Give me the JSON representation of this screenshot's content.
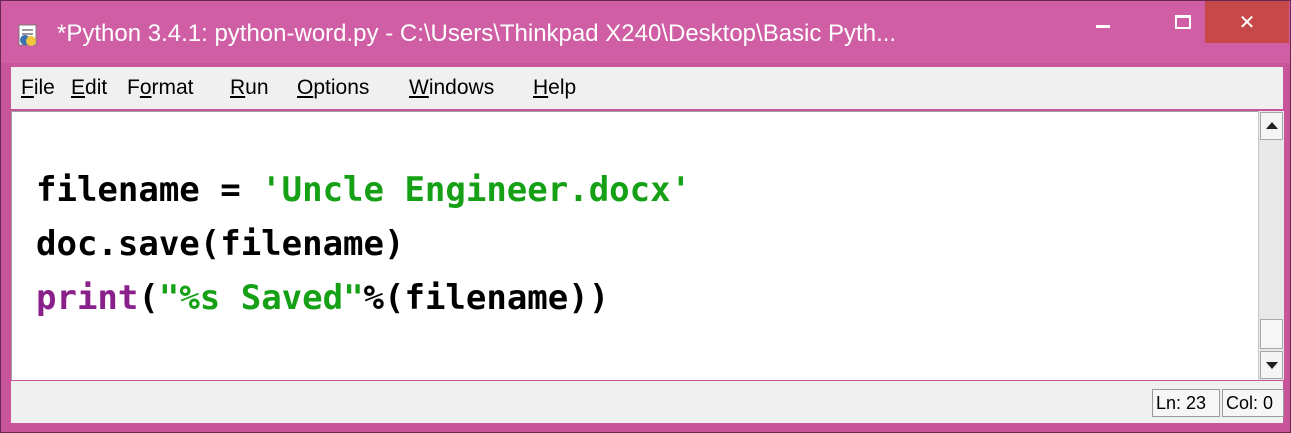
{
  "window": {
    "title": "*Python 3.4.1: python-word.py - C:\\Users\\Thinkpad X240\\Desktop\\Basic Pyth...",
    "icons": {
      "app": "python-idle-icon",
      "minimize": "minimize-icon",
      "maximize": "maximize-icon",
      "close": "close-icon"
    },
    "close_glyph": "✕"
  },
  "menu": {
    "items": [
      {
        "pre": "",
        "ul": "F",
        "post": "ile"
      },
      {
        "pre": "",
        "ul": "E",
        "post": "dit"
      },
      {
        "pre": "F",
        "ul": "o",
        "post": "rmat"
      },
      {
        "pre": "",
        "ul": "R",
        "post": "un"
      },
      {
        "pre": "",
        "ul": "O",
        "post": "ptions"
      },
      {
        "pre": "",
        "ul": "W",
        "post": "indows"
      },
      {
        "pre": "",
        "ul": "H",
        "post": "elp"
      }
    ]
  },
  "editor": {
    "line1": {
      "var": "filename = ",
      "string": "'Uncle Engineer.docx'"
    },
    "line2": {
      "text": "doc.save(filename)"
    },
    "line3": {
      "keyword": "print",
      "paren_open": "(",
      "string": "\"%s Saved\"",
      "rest": "%(filename))"
    }
  },
  "status": {
    "ln": "Ln: 23",
    "col": "Col: 0"
  },
  "colors": {
    "titlebar": "#d05ea4",
    "close_button": "#c64848",
    "string": "#16a016",
    "keyword": "#8a208a"
  }
}
